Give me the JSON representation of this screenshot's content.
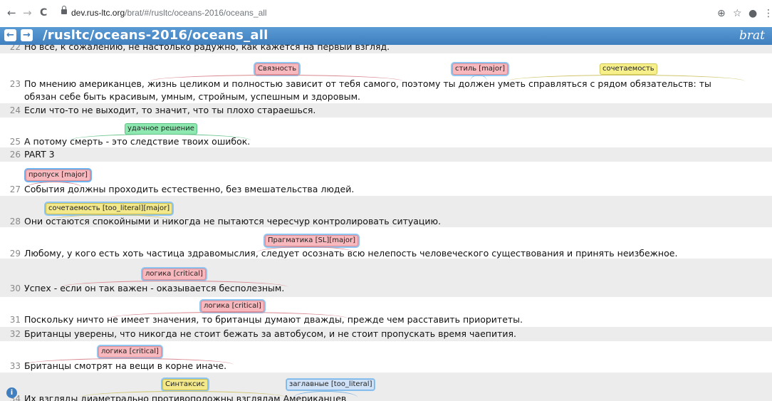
{
  "browser": {
    "back": "←",
    "forward": "→",
    "reload": "C",
    "url_host": "dev.rus-ltc.org",
    "url_path": "/brat/#/rusltc/oceans-2016/oceans_all",
    "zoom_icon": "⊕",
    "star_icon": "☆",
    "account_icon": "●",
    "menu_icon": "⋮"
  },
  "brat": {
    "title": "/rusltc/oceans-2016/oceans_all",
    "logo": "brat",
    "prev": "←",
    "next": "→"
  },
  "sentences": [
    {
      "n": "22",
      "text": "Но все, к сожалению, не настолько радужно, как кажется на первый взгляд."
    },
    {
      "n": "23",
      "text": "По мнению американцев, жизнь целиком и полностью зависит от тебя самого, поэтому      ты      должен уметь справляться с рядом обязательств: ты",
      "text2": "обязан себе быть красивым, умным, стройным, успешным и здоровым."
    },
    {
      "n": "24",
      "text": "Если что-то не выходит, то значит, что ты плохо стараешься."
    },
    {
      "n": "25",
      "text": "А потому смерть - это следствие твоих ошибок."
    },
    {
      "n": "26",
      "text": "PART 3"
    },
    {
      "n": "27",
      "text": "  События     должны проходить естественно, без вмешательства людей."
    },
    {
      "n": "28",
      "text": "Они  остаются спокойными    и никогда не пытаются чересчур контролировать ситуацию."
    },
    {
      "n": "29",
      "text": "Любому, у кого есть хоть частица здравомыслия,  следует осознать  всю нелепость человеческого существования и принять неизбежное."
    },
    {
      "n": "30",
      "text": "Успех - если он так важен - оказывается бесполезным."
    },
    {
      "n": "31",
      "text": "Поскольку ничто не имеет значения, то британцы думают дважды, прежде чем расставить приоритеты."
    },
    {
      "n": "32",
      "text": "Британцы уверены, что никогда не стоит бежать за автобусом, и не стоит пропускать время чаепития."
    },
    {
      "n": "33",
      "text": "Британцы смотрят на вещи в корне иначе."
    },
    {
      "n": "34",
      "text": "Их взгляды диаметрально противоположны взглядам    Американцев"
    }
  ],
  "labels": {
    "l23a": "Связность",
    "l23b": "стиль [major]",
    "l23c": "сочетаемость",
    "l25": "удачное решение",
    "l27": "пропуск [major]",
    "l28": "сочетаемость [too_literal][major]",
    "l29": "Прагматика [SL][major]",
    "l30": "логика [critical]",
    "l31": "логика [critical]",
    "l33": "логика [critical]",
    "l34a": "Синтаксис",
    "l34b": "заглавные [too_literal]"
  },
  "colors": {
    "header": "#4a8ccb",
    "error_label": "#f7b8be",
    "style_label": "#f7f08a",
    "good_label": "#8ee9b0"
  }
}
